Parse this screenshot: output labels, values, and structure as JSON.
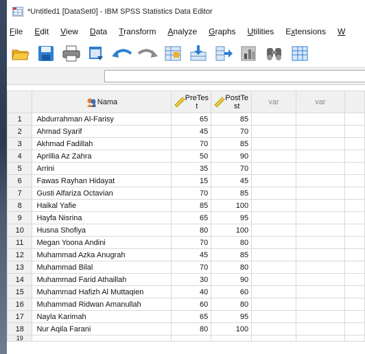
{
  "window": {
    "title": "*Untitled1 [DataSet0] - IBM SPSS Statistics Data Editor"
  },
  "menu": [
    {
      "label": "File",
      "u": "F",
      "rest": "ile"
    },
    {
      "label": "Edit",
      "u": "E",
      "rest": "dit"
    },
    {
      "label": "View",
      "u": "V",
      "rest": "iew"
    },
    {
      "label": "Data",
      "u": "D",
      "rest": "ata"
    },
    {
      "label": "Transform",
      "u": "T",
      "rest": "ransform"
    },
    {
      "label": "Analyze",
      "u": "A",
      "rest": "nalyze"
    },
    {
      "label": "Graphs",
      "u": "G",
      "rest": "raphs"
    },
    {
      "label": "Utilities",
      "u": "U",
      "rest": "tilities"
    },
    {
      "label": "Extensions",
      "u": "x",
      "pre": "E",
      "rest": "tensions"
    },
    {
      "label": "W",
      "u": "W",
      "rest": ""
    }
  ],
  "toolbar": [
    "open-folder-icon",
    "save-icon",
    "print-icon",
    "dialog-recall-icon",
    "undo-icon",
    "redo-icon",
    "goto-case-icon",
    "goto-variable-icon",
    "variables-icon",
    "run-descriptives-icon",
    "find-icon",
    "insert-cases-icon"
  ],
  "columns": {
    "nama": "Nama",
    "pretest_a": "PreTes",
    "pretest_b": "t",
    "posttest_a": "PostTe",
    "posttest_b": "st",
    "var1": "var",
    "var2": "var"
  },
  "rows": [
    {
      "n": "1",
      "nama": "Abdurrahman Al-Farisy",
      "pre": "65",
      "post": "85"
    },
    {
      "n": "2",
      "nama": "Ahmad Syarif",
      "pre": "45",
      "post": "70"
    },
    {
      "n": "3",
      "nama": "Akhmad Fadillah",
      "pre": "70",
      "post": "85"
    },
    {
      "n": "4",
      "nama": "Aprillia Az Zahra",
      "pre": "50",
      "post": "90"
    },
    {
      "n": "5",
      "nama": "Arrini",
      "pre": "35",
      "post": "70"
    },
    {
      "n": "6",
      "nama": "Fawas Rayhan Hidayat",
      "pre": "15",
      "post": "45"
    },
    {
      "n": "7",
      "nama": "Gusti Alfariza Octavian",
      "pre": "70",
      "post": "85"
    },
    {
      "n": "8",
      "nama": "Haikal Yafie",
      "pre": "85",
      "post": "100"
    },
    {
      "n": "9",
      "nama": "Hayfa Nisrina",
      "pre": "65",
      "post": "95"
    },
    {
      "n": "10",
      "nama": "Husna Shofiya",
      "pre": "80",
      "post": "100"
    },
    {
      "n": "11",
      "nama": "Megan Yoona Andini",
      "pre": "70",
      "post": "80"
    },
    {
      "n": "12",
      "nama": "Muhammad Azka Anugrah",
      "pre": "45",
      "post": "85"
    },
    {
      "n": "13",
      "nama": "Muhammad Bilal",
      "pre": "70",
      "post": "80"
    },
    {
      "n": "14",
      "nama": "Muhammad Farid Athaillah",
      "pre": "30",
      "post": "90"
    },
    {
      "n": "15",
      "nama": "Muhammad Hafizh Al Muttaqien",
      "pre": "40",
      "post": "60"
    },
    {
      "n": "16",
      "nama": "Muhammad Ridwan Amanullah",
      "pre": "60",
      "post": "80"
    },
    {
      "n": "17",
      "nama": "Nayla Karimah",
      "pre": "65",
      "post": "95"
    },
    {
      "n": "18",
      "nama": "Nur Aqila Farani",
      "pre": "80",
      "post": "100"
    }
  ],
  "partial_row": "19"
}
